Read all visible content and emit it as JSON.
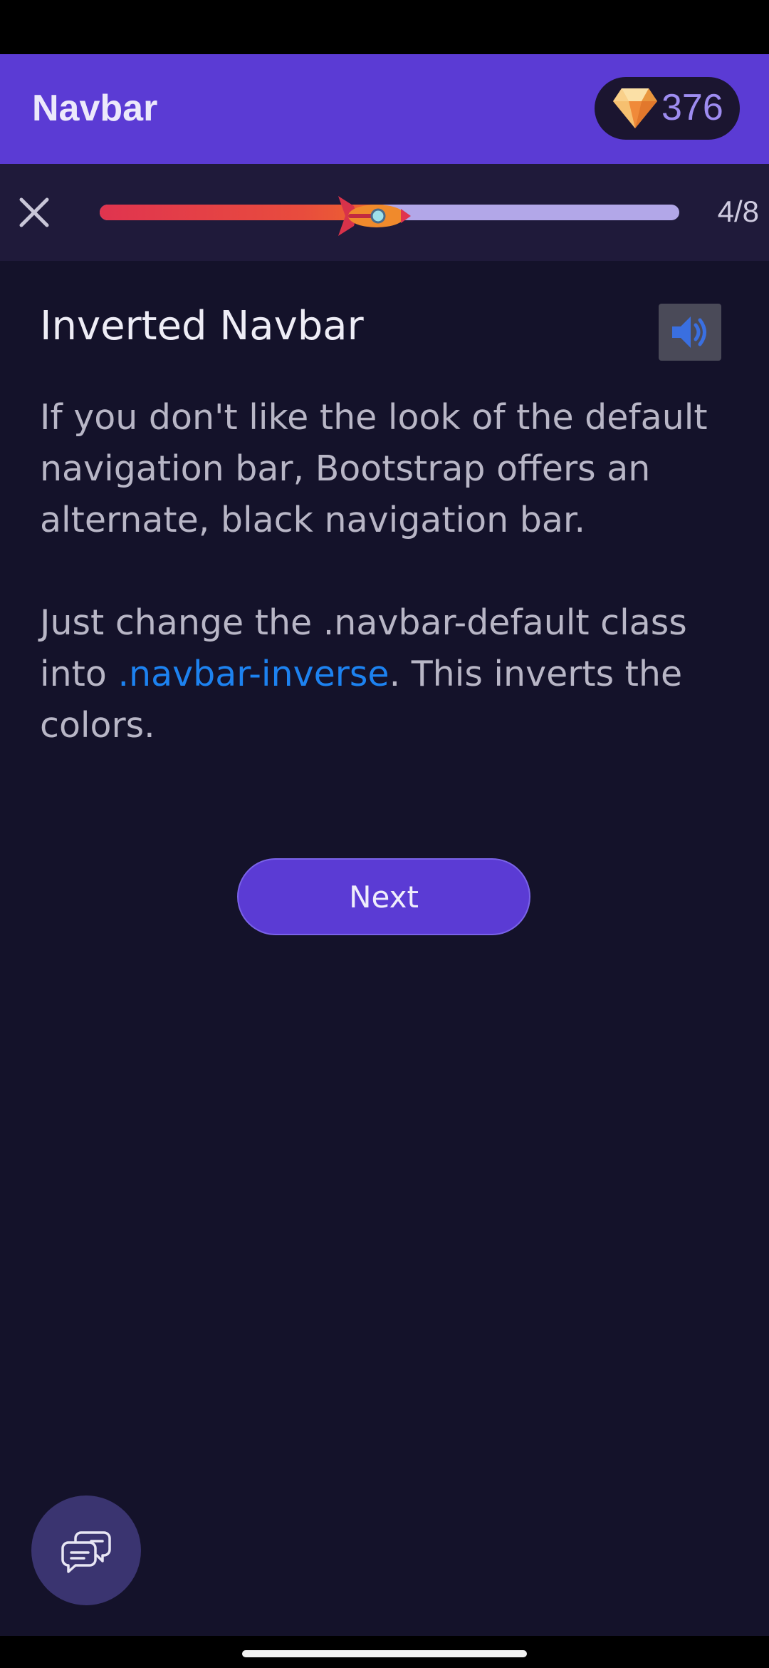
{
  "app_bar": {
    "title": "Navbar",
    "gem_count": "376"
  },
  "progress": {
    "label": "4/8",
    "fraction": 0.5
  },
  "lesson": {
    "title": "Inverted Navbar",
    "paragraph1": "If you don't like the look of the default navigation bar, Bootstrap offers an alternate, black navigation bar.",
    "paragraph2_before": "Just change the .navbar-default class into ",
    "paragraph2_code": ".navbar-inverse",
    "paragraph2_after": ". This inverts the colors."
  },
  "actions": {
    "next_label": "Next"
  },
  "icons": {
    "close": "close-icon",
    "gem": "diamond-icon",
    "rocket": "rocket-icon",
    "audio": "speaker-icon",
    "chat": "chat-bubbles-icon"
  },
  "colors": {
    "primary": "#5b3bd4",
    "background": "#14122a",
    "link": "#1d82f0",
    "progress_fill_start": "#e0344f",
    "progress_track": "#b2a7e8"
  }
}
